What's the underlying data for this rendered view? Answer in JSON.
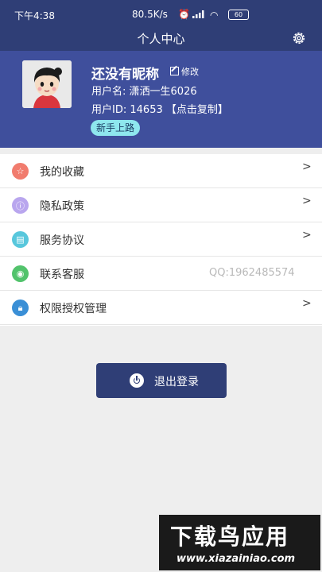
{
  "status_bar": {
    "time": "下午4:38",
    "net_speed": "80.5K/s",
    "battery": "60"
  },
  "header": {
    "title": "个人中心"
  },
  "profile": {
    "nickname": "还没有昵称",
    "edit_label": "修改",
    "username_label": "用户名:",
    "username_value": "潇洒一生6026",
    "userid_label": "用户ID:",
    "userid_value": "14653",
    "copy_label": "【点击复制】",
    "badge": "新手上路"
  },
  "menu": [
    {
      "label": "我的收藏",
      "icon": "star-icon",
      "color": "#f17c6e",
      "chevron": ">"
    },
    {
      "label": "隐私政策",
      "icon": "info-icon",
      "color": "#b9a6ee",
      "chevron": ">"
    },
    {
      "label": "服务协议",
      "icon": "document-icon",
      "color": "#58c7dc",
      "chevron": ">"
    },
    {
      "label": "联系客服",
      "icon": "chat-icon",
      "color": "#52c36c",
      "extra": "QQ:1962485574"
    },
    {
      "label": "权限授权管理",
      "icon": "lock-icon",
      "color": "#3a8fd6",
      "chevron": ">"
    }
  ],
  "logout": {
    "label": "退出登录"
  },
  "watermark": {
    "title": "下载鸟应用",
    "url": "www.xiazainiao.com"
  },
  "colors": {
    "primary": "#2f3e76",
    "profile_bg": "#3f4f9c",
    "badge_bg": "#8ee7ee"
  }
}
